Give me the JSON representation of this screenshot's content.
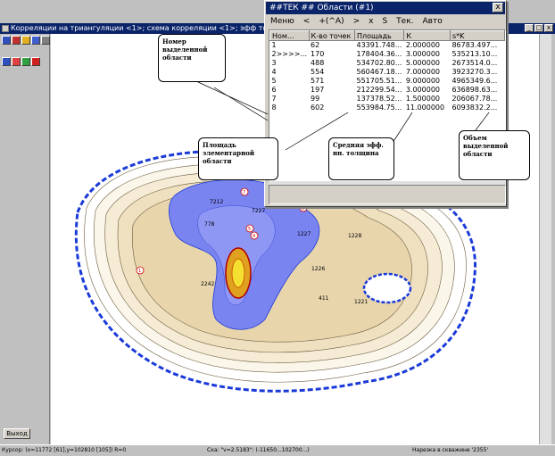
{
  "window": {
    "title": "Корреляции на триангуляции <1>; схема корреляции <1>; эфф толщину колл",
    "min": "_",
    "max": "□",
    "close": "x"
  },
  "left_panel": {
    "exit_label": "Выход"
  },
  "dialog": {
    "title": "##ТЕК ## Области (#1)",
    "close": "x",
    "menu": [
      "Меню",
      "<",
      "+(^A)",
      ">",
      "x",
      "S",
      "Тек.",
      "Авто"
    ],
    "columns": [
      "Ном...",
      "К-во точек",
      "Площадь",
      "К",
      "s*K"
    ],
    "rows": [
      [
        "1",
        "62",
        "43391.748...",
        "2.000000",
        "86783.497..."
      ],
      [
        "2>>>>...",
        "170",
        "178404.36...",
        "3.000000",
        "535213.10..."
      ],
      [
        "3",
        "488",
        "534702.80...",
        "5.000000",
        "2673514.0..."
      ],
      [
        "4",
        "554",
        "560467.18...",
        "7.000000",
        "3923270.3..."
      ],
      [
        "5",
        "571",
        "551705.51...",
        "9.000000",
        "4965349.6..."
      ],
      [
        "6",
        "197",
        "212299.54...",
        "3.000000",
        "636898.63..."
      ],
      [
        "7",
        "99",
        "137378.52...",
        "1.500000",
        "206067.78..."
      ],
      [
        "8",
        "602",
        "553984.75...",
        "11.000000",
        "6093832.2..."
      ]
    ]
  },
  "callouts": {
    "number": "Номер выделенной области",
    "area": "Площадь элементарной области",
    "thickness": "Средняя эфф. нн. толщина",
    "volume": "Объем выделенной области"
  },
  "map": {
    "labels": [
      "7212",
      "7227",
      "778",
      "2242",
      "1227",
      "1226",
      "1228",
      "411",
      "1221",
      "1",
      "2",
      "3",
      "4",
      "5",
      "6",
      "7"
    ]
  },
  "statusbar": {
    "cursor": "Курсор: (x=11772 [61],y=102810 [105]) R=0",
    "scale": "Ска: \"v=2.5183\": (-11650...102700...)",
    "info": "Нарезка в скважине '2355'"
  },
  "colors": {
    "title_bar": "#0a246a",
    "boundary": "#1a3ad8",
    "selected_area": "#7a84f0",
    "contour_fill": "#e8d9b4",
    "contour_line": "#6b5a3c"
  }
}
